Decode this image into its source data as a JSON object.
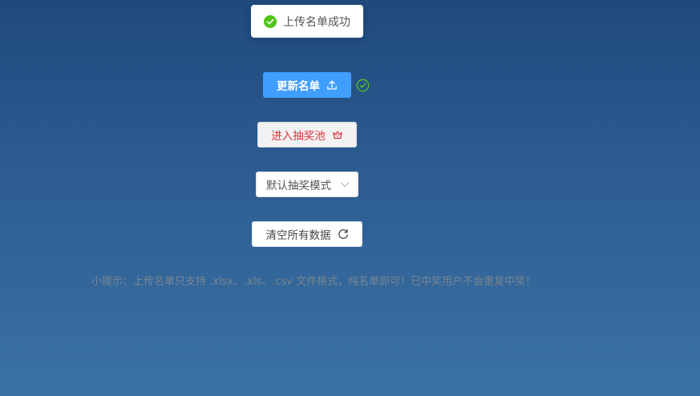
{
  "toast": {
    "message": "上传名单成功",
    "icon": "check-circle-icon",
    "icon_color": "#52c41a"
  },
  "update_button": {
    "label": "更新名单",
    "icon": "upload-icon",
    "bg_color": "#409eff",
    "status_icon": "check-circle-outline-icon",
    "status_color": "#52c41a"
  },
  "lottery_button": {
    "label": "进入抽奖池",
    "icon": "crown-icon",
    "text_color": "#e0313c"
  },
  "mode_select": {
    "selected": "默认抽奖模式",
    "icon": "chevron-down-icon"
  },
  "clear_button": {
    "label": "清空所有数据",
    "icon": "refresh-icon"
  },
  "tip": {
    "text": "小提示：上传名单只支持 .xlsx、.xls、.csv 文件格式，纯名单即可！已中奖用户不会重复中奖！"
  }
}
